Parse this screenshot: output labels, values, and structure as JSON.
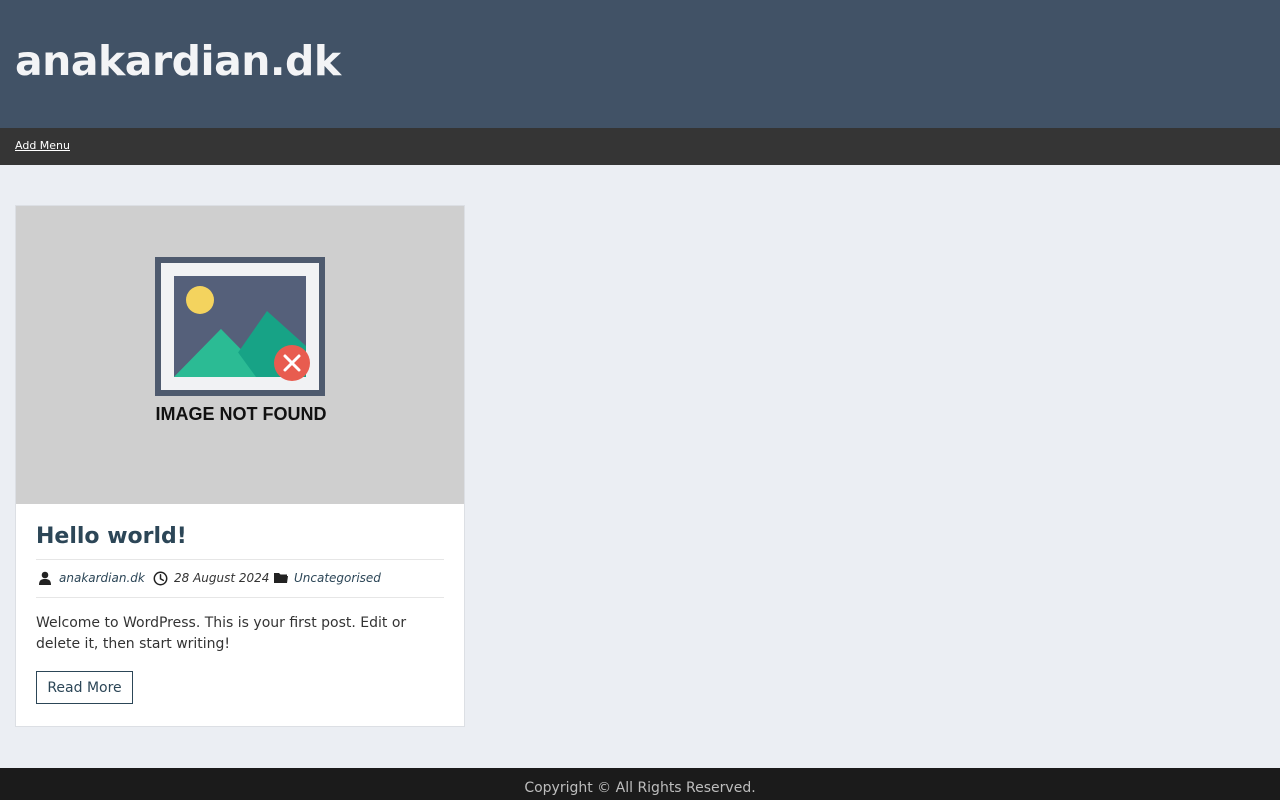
{
  "header": {
    "site_title": "anakardian.dk"
  },
  "nav": {
    "menu_link": "Add Menu"
  },
  "post": {
    "thumbnail_caption": "IMAGE NOT FOUND",
    "title": "Hello world!",
    "meta": {
      "author": "anakardian.dk",
      "author_icon": "user-icon",
      "date": "28 August 2024",
      "date_icon": "clock-icon",
      "category": "Uncategorised",
      "category_icon": "folder-icon"
    },
    "excerpt": "Welcome to WordPress. This is your first post. Edit or delete it, then start writing!",
    "read_more_label": "Read More"
  },
  "footer": {
    "copyright": "Copyright © All Rights Reserved."
  },
  "colors": {
    "header_bg": "#415266",
    "nav_bg": "#353535",
    "page_bg": "#ebeef3",
    "accent": "#2c4657",
    "footer_bg": "#1b1b1b"
  }
}
